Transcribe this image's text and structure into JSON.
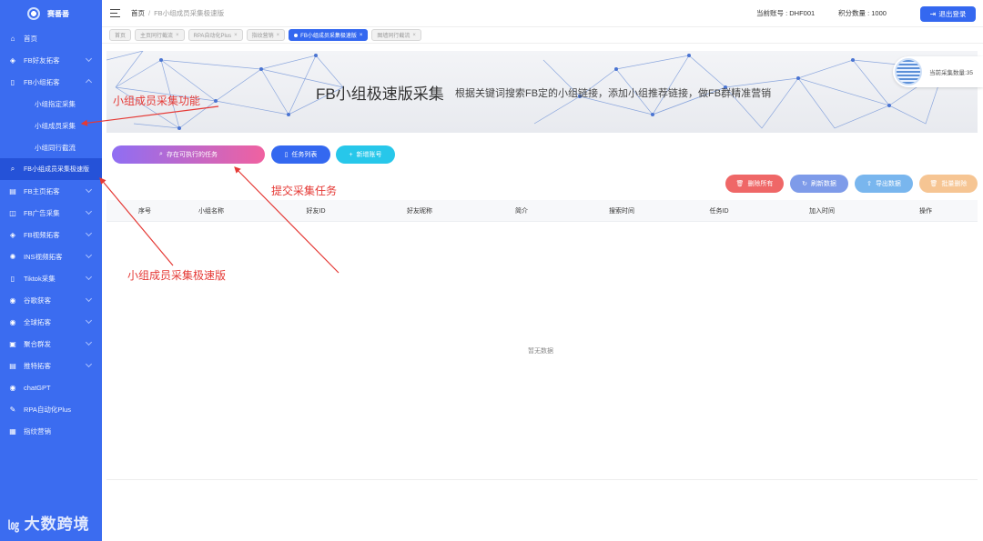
{
  "brand": {
    "name": "赛番番"
  },
  "sidebar": {
    "items": [
      {
        "label": "首页",
        "icon": "home-icon"
      },
      {
        "label": "FB好友拓客",
        "icon": "layers-icon"
      },
      {
        "label": "FB小组拓客",
        "icon": "book-icon"
      },
      {
        "label": "小组指定采集"
      },
      {
        "label": "小组成员采集"
      },
      {
        "label": "小组同行截流"
      },
      {
        "label": "FB小组成员采集极速版",
        "icon": "search-icon"
      },
      {
        "label": "FB主页拓客",
        "icon": "page-icon"
      },
      {
        "label": "FB广告采集",
        "icon": "ad-icon"
      },
      {
        "label": "FB视频拓客",
        "icon": "layers-icon"
      },
      {
        "label": "INS视频拓客",
        "icon": "camera-icon"
      },
      {
        "label": "Tiktok采集",
        "icon": "book-icon"
      },
      {
        "label": "谷歌获客",
        "icon": "globe-icon"
      },
      {
        "label": "全球拓客",
        "icon": "globe-icon"
      },
      {
        "label": "聚合群发",
        "icon": "grid-icon"
      },
      {
        "label": "推特拓客",
        "icon": "list-icon"
      },
      {
        "label": "chatGPT",
        "icon": "chat-icon"
      },
      {
        "label": "RPA自动化Plus",
        "icon": "edit-icon"
      },
      {
        "label": "指纹营销",
        "icon": "fingerprint-icon"
      }
    ]
  },
  "header": {
    "breadcrumb_home": "首页",
    "breadcrumb_sep": "/",
    "breadcrumb_current": "FB小组成员采集极速版",
    "account": "当前账号 : DHF001",
    "points": "积分数量 : 1000",
    "logout": "退出登录"
  },
  "tabs": [
    {
      "label": "首页"
    },
    {
      "label": "主页同行截流"
    },
    {
      "label": "RPA自动化Plus"
    },
    {
      "label": "指纹营销"
    },
    {
      "label": "FB小组成员采集极速版"
    },
    {
      "label": "图墙同行截流"
    }
  ],
  "banner": {
    "title": "FB小组极速版采集",
    "description": "根据关键词搜索FB定的小组链接，添加小组推荐链接，做FB群精准营销",
    "count_text": "当前采集数量:35"
  },
  "actions": {
    "tasks": "存在可执行的任务",
    "task_list": "任务列表",
    "add_account": "新增账号",
    "delete_all": "删除所有",
    "refresh": "刷新数据",
    "export": "导出数据",
    "batch_delete": "批量删除"
  },
  "table": {
    "columns": [
      "序号",
      "小组名称",
      "好友ID",
      "好友昵称",
      "简介",
      "搜索时间",
      "任务ID",
      "加入时间",
      "操作"
    ],
    "empty_text": "暂无数据"
  },
  "annotations": {
    "member_feature": "小组成员采集功能",
    "submit_task": "提交采集任务",
    "fast_version": "小组成员采集极速版"
  },
  "watermark": "大数跨境",
  "colors": {
    "sidebar": "#3b6cf0",
    "primary": "#3468f0",
    "annotation": "#e53935"
  }
}
